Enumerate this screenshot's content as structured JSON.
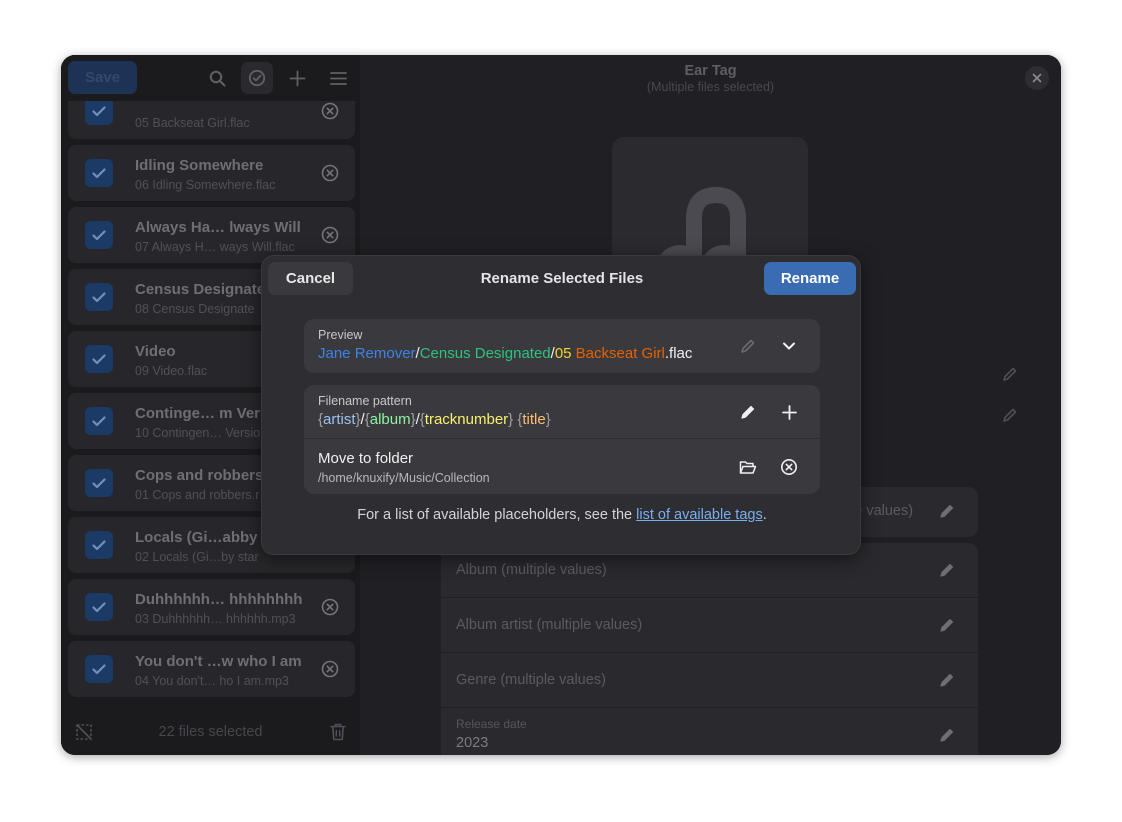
{
  "sidebar": {
    "save_label": "Save",
    "selected_count": "22 files selected",
    "items": [
      {
        "title": "",
        "file": "05 Backseat Girl.flac",
        "removable": true
      },
      {
        "title": "Idling Somewhere",
        "file": "06 Idling Somewhere.flac",
        "removable": true
      },
      {
        "title": "Always Ha… lways Will",
        "file": "07 Always H… ways Will.flac",
        "removable": true
      },
      {
        "title": "Census Designate",
        "file": "08 Census Designate",
        "removable": false
      },
      {
        "title": "Video",
        "file": "09 Video.flac",
        "removable": false
      },
      {
        "title": "Continge… m Ver",
        "file": "10 Contingen… Versio",
        "removable": false
      },
      {
        "title": "Cops and robbers",
        "file": "01 Cops and robbers.r",
        "removable": false
      },
      {
        "title": "Locals (Gi…abby",
        "file": "02 Locals (Gi…by star",
        "removable": false
      },
      {
        "title": "Duhhhhhh… hhhhhhhh",
        "file": "03 Duhhhhhh… hhhhhh.mp3",
        "removable": true
      },
      {
        "title": "You don't …w who I am",
        "file": "04 You don't… ho I am.mp3",
        "removable": true
      }
    ]
  },
  "main": {
    "title": "Ear Tag",
    "subtitle": "(Multiple files selected)",
    "fields": [
      {
        "label": "le values)"
      },
      {
        "label": "Album (multiple values)"
      },
      {
        "label": "Album artist (multiple values)"
      },
      {
        "label": "Genre (multiple values)"
      },
      {
        "label": "Release date",
        "value": "2023"
      }
    ]
  },
  "dialog": {
    "cancel_label": "Cancel",
    "title": "Rename Selected Files",
    "rename_label": "Rename",
    "preview": {
      "label": "Preview",
      "artist": "Jane Remover",
      "sep1": "/",
      "album": "Census Designated",
      "sep2": "/",
      "track": "05",
      "space": " ",
      "title": "Backseat Girl",
      "ext": ".flac"
    },
    "pattern": {
      "label": "Filename pattern",
      "open": "{",
      "close": "}",
      "artist": "artist",
      "sep1": "/",
      "album": "album",
      "sep2": "/",
      "track": "tracknumber",
      "space": " ",
      "title": "title"
    },
    "move": {
      "label": "Move to folder",
      "path": "/home/knuxify/Music/Collection"
    },
    "hint_prefix": "For a list of available placeholders, see the ",
    "hint_link": "list of available tags",
    "hint_suffix": "."
  },
  "colors": {
    "accent": "#3a6cb4",
    "artist": "#3f82e4",
    "album": "#2ec27e",
    "track": "#f6d32d",
    "title": "#e66100"
  }
}
